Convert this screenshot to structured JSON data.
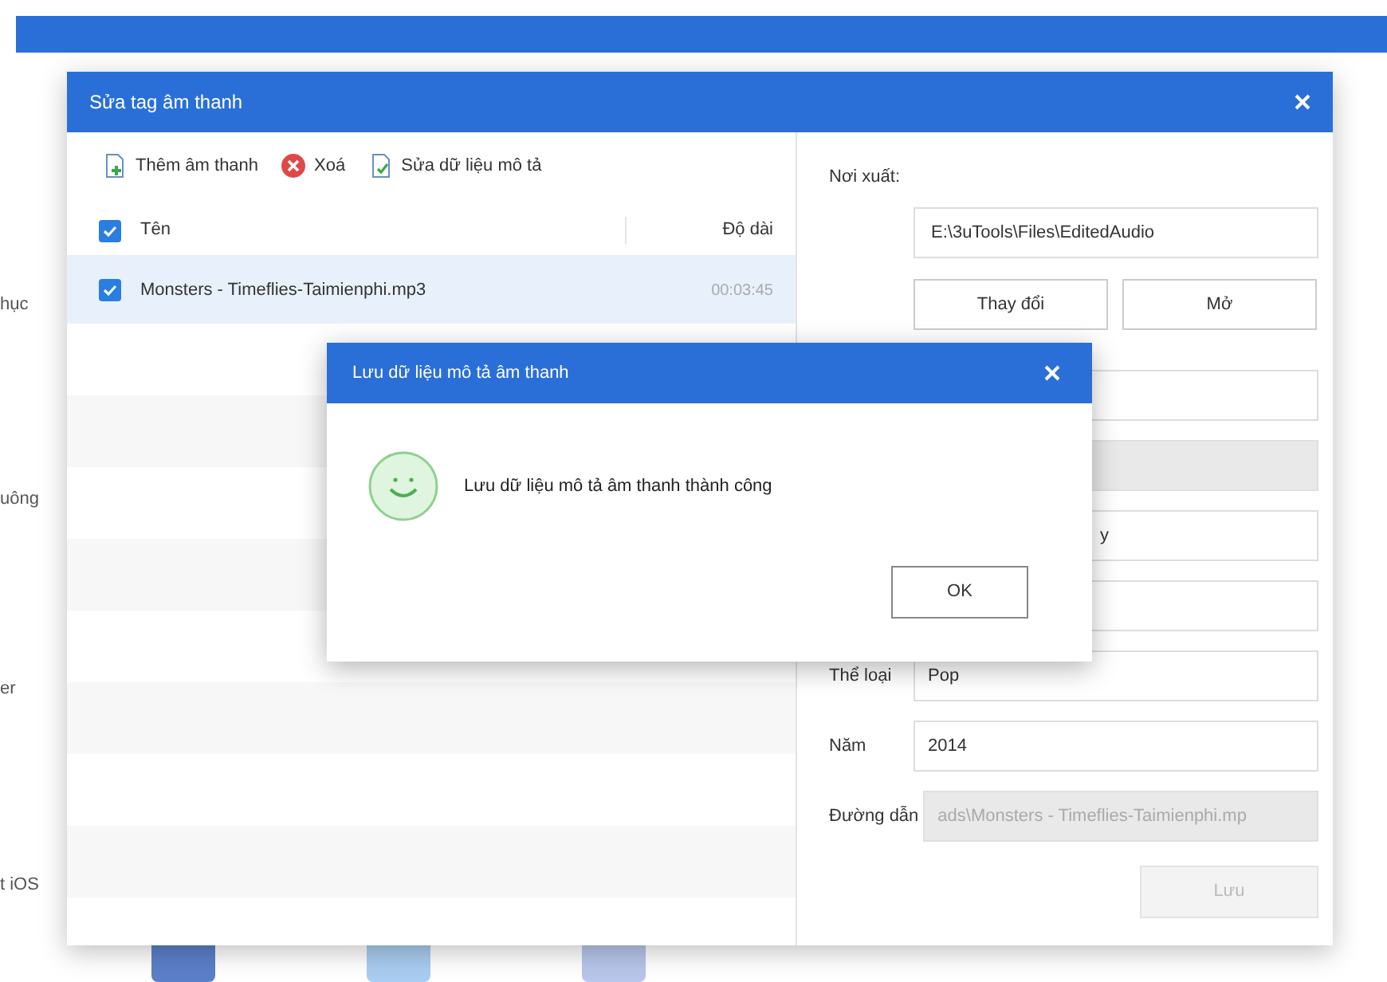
{
  "sidebar_items": [
    "hục",
    "uông",
    "er",
    "t iOS"
  ],
  "editor_dialog": {
    "title": "Sửa tag âm thanh",
    "toolbar": [
      {
        "label": "Thêm âm thanh",
        "kind": "add"
      },
      {
        "label": "Xoá",
        "kind": "delete"
      },
      {
        "label": "Sửa dữ liệu mô tả",
        "kind": "edit"
      }
    ],
    "columns": [
      "Tên",
      "Độ dài"
    ],
    "all_checked": true,
    "rows": [
      {
        "name": "Monsters - Timeflies-Taimienphi.mp3",
        "duration": "00:03:45",
        "checked": true,
        "selected": true
      }
    ],
    "output_label": "Nơi xuất:",
    "output_path": "E:\\3uTools\\Files\\EditedAudio",
    "buttons": [
      "Thay đổi",
      "Mở"
    ],
    "fields": [
      {
        "disabled": false
      },
      {
        "disabled": true
      },
      {
        "value": "y",
        "disabled": false
      },
      {
        "disabled": false
      },
      {
        "label": "Thể loại",
        "value": "Pop",
        "disabled": false
      },
      {
        "label": "Năm",
        "value": "2014",
        "disabled": false
      },
      {
        "label": "Đường dẫn",
        "value": "ads\\Monsters - Timeflies-Taimienphi.mp",
        "disabled": true
      }
    ],
    "save_button": {
      "label": "Lưu",
      "disabled": true
    }
  },
  "message_dialog": {
    "title": "Lưu dữ liệu mô tả âm thanh",
    "kind": "success",
    "message": "Lưu dữ liệu mô tả âm thanh thành công",
    "button": "OK"
  }
}
